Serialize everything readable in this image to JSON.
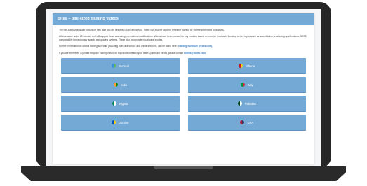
{
  "header": {
    "title": "Bites – bite-sized training videos"
  },
  "paragraphs": {
    "p1": "The bite-sized videos aim to support new staff and are designed as a training tool. These can also be used for refresher training for more experienced colleagues.",
    "p2": "All videos are under 20 minutes and will support those assessing international qualifications. Videos have been created for key markets based on member feedback, focusing on key topics such as accreditation, evaluating qualifications, GCSE comparability for secondary awards and grading systems. These also incorporate visual case studies.",
    "p3_text": "Further information on our full training schedule (including both face to face and online sessions, can be found here:",
    "p3_link": "Training Schedule (ecctis.com).",
    "p4_text": "If you are interested in private bespoke training based on topics which reflect your team's particular needs, please contact",
    "p4_link": "events@ecctis.com"
  },
  "countries": [
    {
      "label": "General",
      "icon": "globe-icon",
      "colors": [
        "#3a8fd9",
        "#5cb85c"
      ]
    },
    {
      "label": "Ghana",
      "icon": "ghana-flag-icon",
      "colors": [
        "#ce1126",
        "#fcd116"
      ]
    },
    {
      "label": "India",
      "icon": "india-flag-icon",
      "colors": [
        "#ff9933",
        "#138808"
      ]
    },
    {
      "label": "Italy",
      "icon": "italy-flag-icon",
      "colors": [
        "#009246",
        "#ce2b37"
      ]
    },
    {
      "label": "Nigeria",
      "icon": "nigeria-flag-icon",
      "colors": [
        "#008751",
        "#ffffff"
      ]
    },
    {
      "label": "Pakistan",
      "icon": "pakistan-flag-icon",
      "colors": [
        "#01411c",
        "#ffffff"
      ]
    },
    {
      "label": "Ukraine",
      "icon": "ukraine-flag-icon",
      "colors": [
        "#0057b7",
        "#ffd700"
      ]
    },
    {
      "label": "USA",
      "icon": "usa-flag-icon",
      "colors": [
        "#b22234",
        "#3c3b6e"
      ]
    }
  ],
  "colors": {
    "accent": "#74a9d6",
    "link": "#3d7fc1",
    "laptop_frame": "#262626"
  }
}
